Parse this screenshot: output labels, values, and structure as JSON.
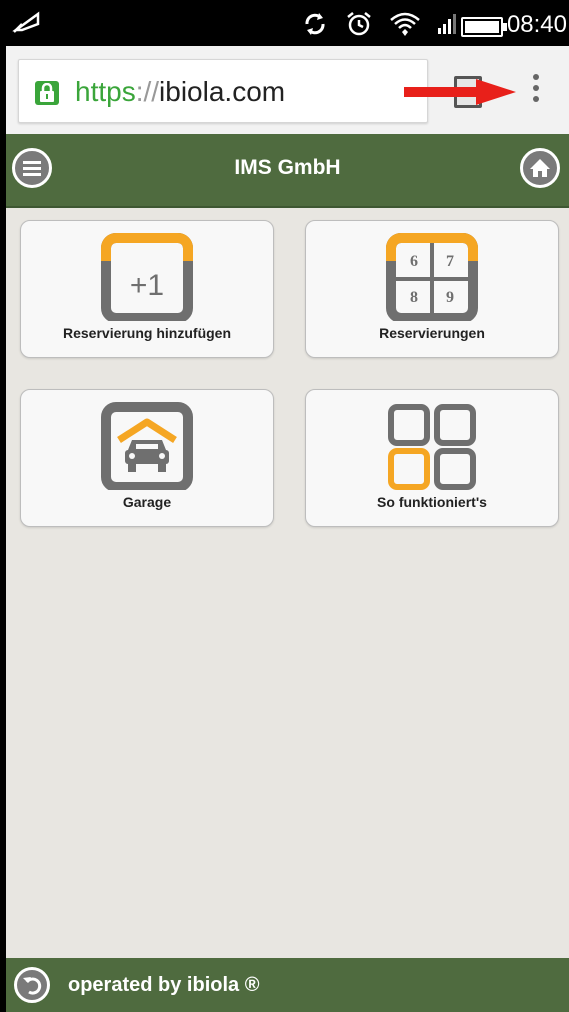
{
  "status": {
    "time": "08:40"
  },
  "browser": {
    "url_scheme": "https",
    "url_sep": "://",
    "url_host": "ibiola.com"
  },
  "header": {
    "title": "IMS GmbH"
  },
  "tiles": [
    {
      "label": "Reservierung hinzufügen",
      "icon_text": "+1"
    },
    {
      "label": "Reservierungen",
      "icon_digits": [
        "6",
        "7",
        "8",
        "9"
      ]
    },
    {
      "label": "Garage"
    },
    {
      "label": "So funktioniert's"
    }
  ],
  "footer": {
    "text": "operated by ibiola ®"
  },
  "colors": {
    "header_green": "#4f6b3f",
    "accent_orange": "#f5a623",
    "icon_gray": "#6f6f6f",
    "secure_green": "#3aa53a"
  }
}
